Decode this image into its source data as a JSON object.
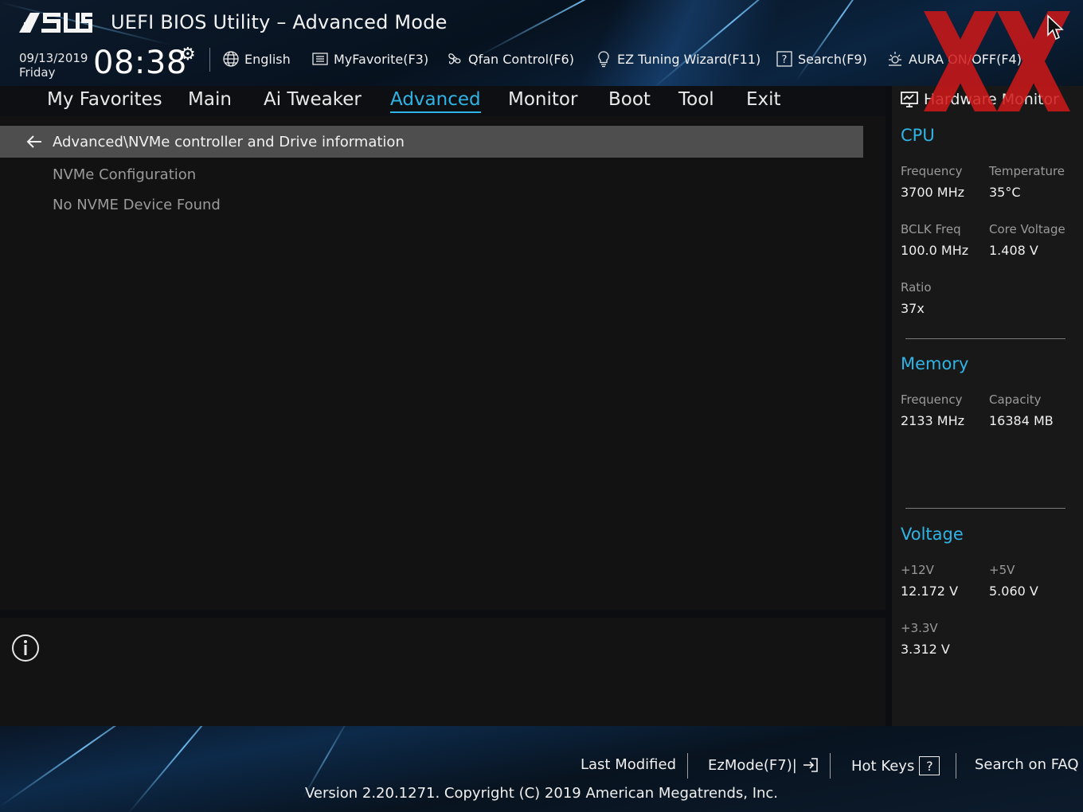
{
  "header": {
    "title": "UEFI BIOS Utility – Advanced Mode",
    "date": "09/13/2019",
    "day": "Friday",
    "time": "08:38"
  },
  "toolbar": {
    "language": "English",
    "myfavorite": "MyFavorite(F3)",
    "qfan": "Qfan Control(F6)",
    "ez_tuning": "EZ Tuning Wizard(F11)",
    "search": "Search(F9)",
    "aura": "AURA ON/OFF(F4)"
  },
  "tabs": [
    {
      "label": "My Favorites"
    },
    {
      "label": "Main"
    },
    {
      "label": "Ai Tweaker"
    },
    {
      "label": "Advanced"
    },
    {
      "label": "Monitor"
    },
    {
      "label": "Boot"
    },
    {
      "label": "Tool"
    },
    {
      "label": "Exit"
    }
  ],
  "active_tab": "Advanced",
  "main": {
    "breadcrumb": "Advanced\\NVMe controller and Drive information",
    "items": [
      {
        "label": "NVMe Configuration"
      },
      {
        "label": "No NVME Device Found"
      }
    ]
  },
  "hw": {
    "title": "Hardware Monitor",
    "cpu": {
      "heading": "CPU",
      "frequency_label": "Frequency",
      "frequency": "3700 MHz",
      "temperature_label": "Temperature",
      "temperature": "35°C",
      "bclk_label": "BCLK Freq",
      "bclk": "100.0 MHz",
      "core_voltage_label": "Core Voltage",
      "core_voltage": "1.408 V",
      "ratio_label": "Ratio",
      "ratio": "37x"
    },
    "memory": {
      "heading": "Memory",
      "frequency_label": "Frequency",
      "frequency": "2133 MHz",
      "capacity_label": "Capacity",
      "capacity": "16384 MB"
    },
    "voltage": {
      "heading": "Voltage",
      "v12_label": "+12V",
      "v12": "12.172 V",
      "v5_label": "+5V",
      "v5": "5.060 V",
      "v33_label": "+3.3V",
      "v33": "3.312 V"
    }
  },
  "footer": {
    "last_modified": "Last Modified",
    "ezmode": "EzMode(F7)|",
    "hot_keys": "Hot Keys",
    "hot_keys_key": "?",
    "search_faq": "Search on FAQ",
    "version": "Version 2.20.1271. Copyright (C) 2019 American Megatrends, Inc."
  },
  "colors": {
    "accent": "#2fb4e6",
    "watermark": "#d01818"
  }
}
